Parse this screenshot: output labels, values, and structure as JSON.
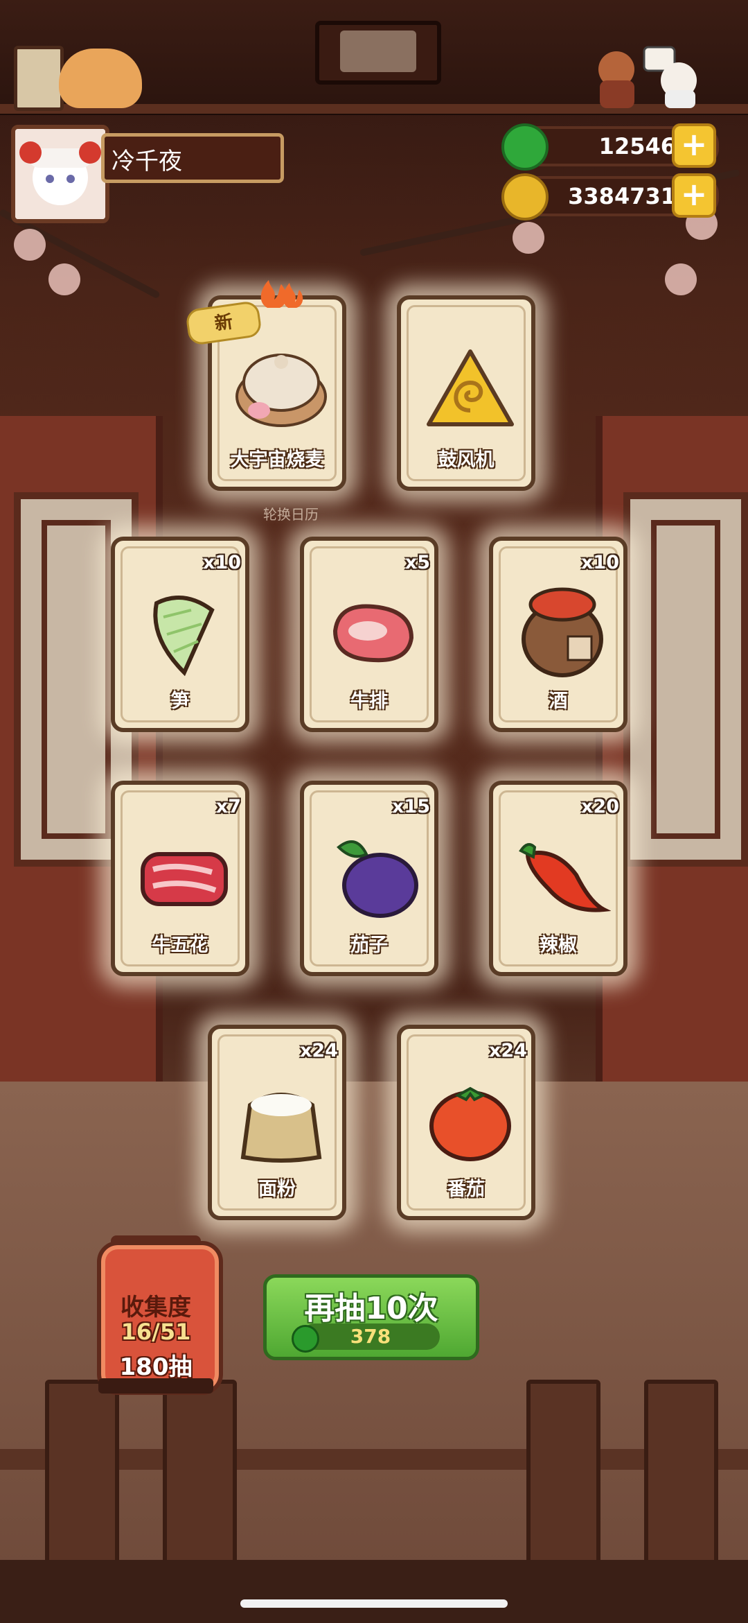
{
  "player": {
    "name": "冷千夜"
  },
  "resources": {
    "jade": {
      "value": "12546",
      "icon": "jade-coin-icon",
      "color": "#2fa83a"
    },
    "gold": {
      "value": "3384731",
      "icon": "gold-coin-icon",
      "color": "#e8b62a"
    },
    "plus_label": "+"
  },
  "new_badge": "新",
  "background_text": "轮换日历",
  "cards": [
    {
      "name": "大宇宙烧麦",
      "count": "",
      "icon": "shaomai-steamer-icon",
      "is_new": true
    },
    {
      "name": "鼓风机",
      "count": "",
      "icon": "bellows-icon"
    },
    {
      "name": "笋",
      "count": "x10",
      "icon": "bamboo-shoot-icon"
    },
    {
      "name": "牛排",
      "count": "x5",
      "icon": "steak-icon"
    },
    {
      "name": "酒",
      "count": "x10",
      "icon": "wine-jar-icon"
    },
    {
      "name": "牛五花",
      "count": "x7",
      "icon": "beef-belly-icon"
    },
    {
      "name": "茄子",
      "count": "x15",
      "icon": "eggplant-icon"
    },
    {
      "name": "辣椒",
      "count": "x20",
      "icon": "chili-icon"
    },
    {
      "name": "面粉",
      "count": "x24",
      "icon": "flour-sack-icon"
    },
    {
      "name": "番茄",
      "count": "x24",
      "icon": "tomato-icon"
    }
  ],
  "collection": {
    "title": "收集度",
    "progress": "16/51",
    "draws": "180抽"
  },
  "draw_again": {
    "label": "再抽10次",
    "cost": "378",
    "cost_icon": "jade-coin-icon"
  }
}
